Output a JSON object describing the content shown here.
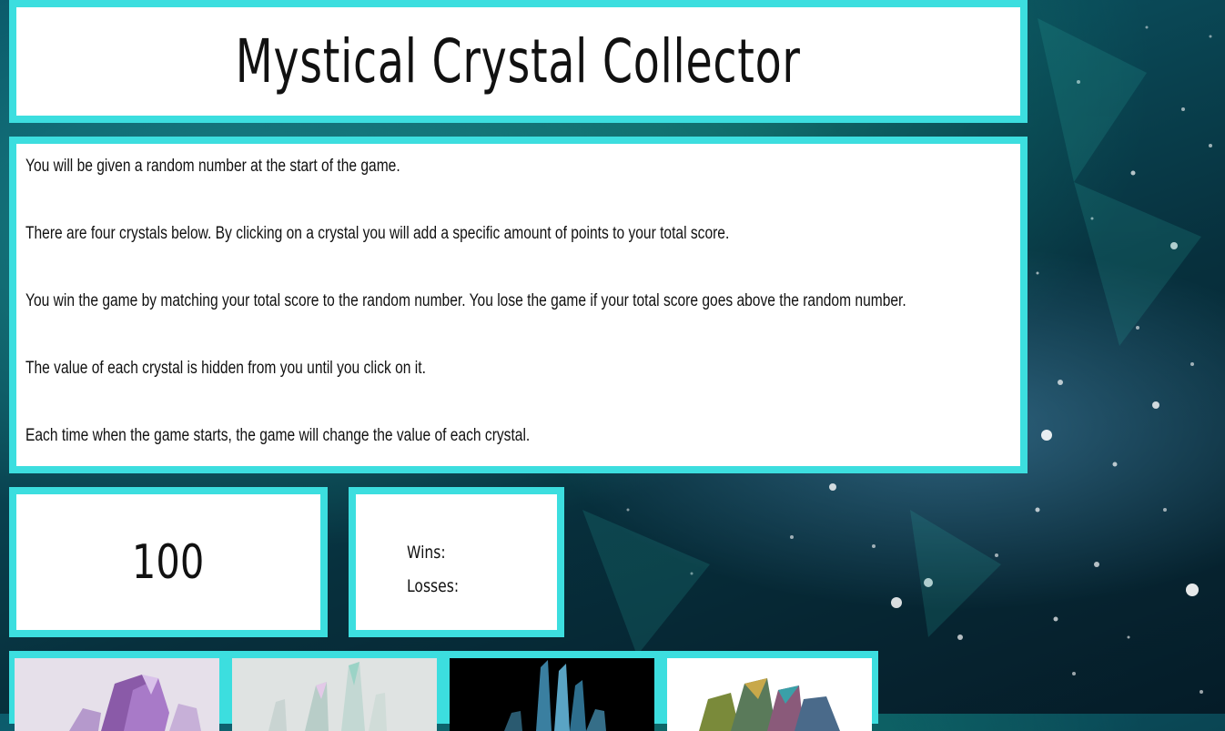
{
  "title": "Mystical Crystal Collector",
  "instructions": [
    "You will be given a random number at the start of the game.",
    "There are four crystals below. By clicking on a crystal you will add a specific amount of points to your total score.",
    "You win the game by matching your total score to the random number. You lose the game if your total score goes above the random number.",
    "The value of each crystal is hidden from you until you click on it.",
    "Each time when the game starts, the game will change the value of each crystal."
  ],
  "target_number": "100",
  "scoreboard": {
    "wins_label": "Wins:",
    "losses_label": "Losses:"
  },
  "crystals": [
    {
      "name": "purple-amethyst-crystal",
      "color": "#9b6cc0"
    },
    {
      "name": "clear-quartz-crystal",
      "color": "#cfd8d6"
    },
    {
      "name": "blue-crystal",
      "color": "#4a8fb0"
    },
    {
      "name": "rainbow-aura-crystal",
      "color": "#6a8a4a"
    }
  ],
  "colors": {
    "border_accent": "#3cdedf",
    "panel_bg": "#ffffff"
  }
}
